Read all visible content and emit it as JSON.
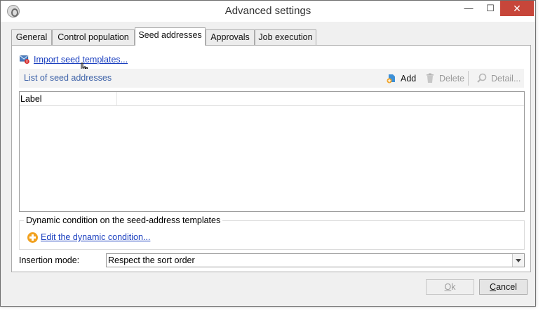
{
  "window": {
    "title": "Advanced settings"
  },
  "tabs": [
    {
      "label": "General"
    },
    {
      "label": "Control population"
    },
    {
      "label": "Seed addresses"
    },
    {
      "label": "Approvals"
    },
    {
      "label": "Job execution"
    }
  ],
  "active_tab": "Seed addresses",
  "seed": {
    "import_link": "Import seed templates...",
    "list_title": "List of seed addresses",
    "toolbar": {
      "add": "Add",
      "delete": "Delete",
      "detail": "Detail..."
    },
    "columns": [
      {
        "label": "Label"
      }
    ],
    "rows": []
  },
  "dynamic": {
    "group_title": "Dynamic condition on the seed-address templates",
    "edit_link": "Edit the dynamic condition..."
  },
  "insertion": {
    "label": "Insertion mode:",
    "value": "Respect the sort order"
  },
  "buttons": {
    "ok": "Ok",
    "cancel": "Cancel"
  },
  "colors": {
    "link": "#1a3fbf",
    "list_title": "#3d62a8",
    "close_button": "#c7463a",
    "accent_add": "#f1a11f"
  },
  "icons": [
    "app-icon",
    "minimize-icon",
    "maximize-icon",
    "close-icon",
    "mail-error-icon",
    "hand-cursor-icon",
    "add-icon",
    "trash-icon",
    "search-icon",
    "plus-circle-icon",
    "dropdown-arrow-icon"
  ]
}
